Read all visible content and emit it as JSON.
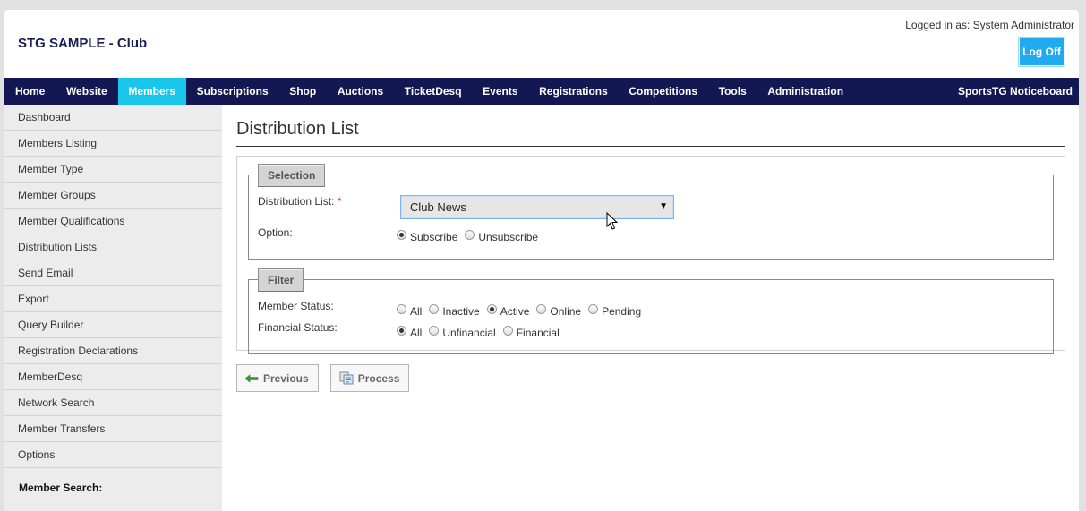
{
  "header": {
    "site_title": "STG SAMPLE - Club",
    "logged_in_text": "Logged in as: System Administrator",
    "logoff_label": "Log Off"
  },
  "nav": {
    "items": [
      {
        "label": "Home"
      },
      {
        "label": "Website"
      },
      {
        "label": "Members",
        "active": true
      },
      {
        "label": "Subscriptions"
      },
      {
        "label": "Shop"
      },
      {
        "label": "Auctions"
      },
      {
        "label": "TicketDesq"
      },
      {
        "label": "Events"
      },
      {
        "label": "Registrations"
      },
      {
        "label": "Competitions"
      },
      {
        "label": "Tools"
      },
      {
        "label": "Administration"
      }
    ],
    "right_label": "SportsTG Noticeboard"
  },
  "sidebar": {
    "items": [
      {
        "label": "Dashboard"
      },
      {
        "label": "Members Listing"
      },
      {
        "label": "Member Type"
      },
      {
        "label": "Member Groups"
      },
      {
        "label": "Member Qualifications"
      },
      {
        "label": "Distribution Lists"
      },
      {
        "label": "Send Email"
      },
      {
        "label": "Export"
      },
      {
        "label": "Query Builder"
      },
      {
        "label": "Registration Declarations"
      },
      {
        "label": "MemberDesq"
      },
      {
        "label": "Network Search"
      },
      {
        "label": "Member Transfers"
      },
      {
        "label": "Options"
      }
    ],
    "search_label": "Member Search:"
  },
  "main": {
    "heading": "Distribution List",
    "selection": {
      "legend": "Selection",
      "distribution_list_label": "Distribution List:",
      "required_mark": "*",
      "distribution_list_value": "Club News",
      "option_label": "Option:",
      "option_choices": [
        "Subscribe",
        "Unsubscribe"
      ],
      "option_selected": "Subscribe"
    },
    "filter": {
      "legend": "Filter",
      "member_status_label": "Member Status:",
      "member_status_choices": [
        "All",
        "Inactive",
        "Active",
        "Online",
        "Pending"
      ],
      "member_status_selected": "Active",
      "financial_status_label": "Financial Status:",
      "financial_status_choices": [
        "All",
        "Unfinancial",
        "Financial"
      ],
      "financial_status_selected": "All"
    },
    "buttons": {
      "previous_label": "Previous",
      "process_label": "Process"
    }
  },
  "colors": {
    "nav_bg": "#141852",
    "nav_active": "#1ac5ec",
    "logoff_bg": "#22aaee",
    "title_color": "#1a1d55"
  }
}
